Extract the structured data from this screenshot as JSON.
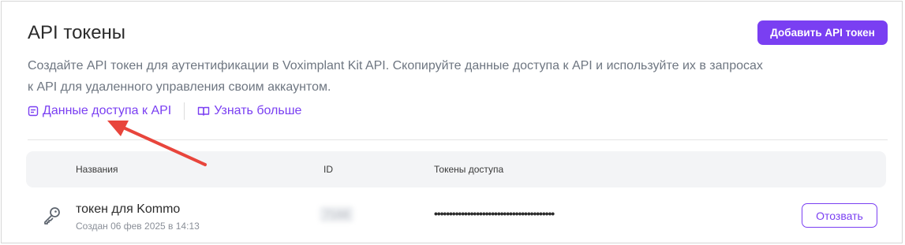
{
  "header": {
    "title": "API токены",
    "add_button_label": "Добавить API токен"
  },
  "description": "Создайте API токен для аутентификации в Voximplant Kit API. Скопируйте данные доступа к API и используйте их в запросах к API для удаленного управления своим аккаунтом.",
  "links": {
    "api_access": {
      "label": "Данные доступа к API",
      "icon": "document-icon"
    },
    "learn_more": {
      "label": "Узнать больше",
      "icon": "book-icon"
    }
  },
  "table": {
    "columns": {
      "name": "Названия",
      "id": "ID",
      "tokens": "Токены доступа"
    },
    "rows": [
      {
        "icon": "key-icon",
        "name": "токен для Kommo",
        "created": "Создан 06 фев 2025 в 14:13",
        "id": "7168",
        "token": "••••••••••••••••••••••••••••••••••••••••",
        "action_label": "Отозвать"
      }
    ]
  },
  "colors": {
    "accent": "#7a3ff2",
    "annotation_arrow": "#e8453c",
    "muted_text": "#6e7681",
    "header_bg": "#f3f4f6"
  }
}
